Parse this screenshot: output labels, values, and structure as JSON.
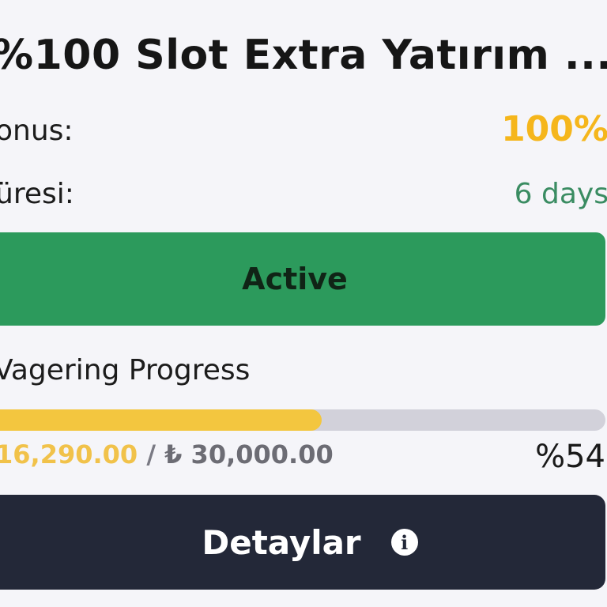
{
  "bonus": {
    "title": "%100 Slot Extra Yatırım ...",
    "bonus_label": "onus:",
    "bonus_value": "100%",
    "duration_label": "üresi:",
    "duration_value": "6 days",
    "status_label": "Active"
  },
  "wagering": {
    "label": "Vagering Progress",
    "current": "16,290.00",
    "separator": "/",
    "total": "₺ 30,000.00",
    "percent_text": "%54",
    "progress_fraction": 0.543
  },
  "details": {
    "label": "Detaylar",
    "icon": "info-icon"
  },
  "colors": {
    "accent_yellow": "#f5b61c",
    "active_green": "#2c9a5c",
    "days_green": "#3a8c62",
    "progress_fill": "#f3c63f",
    "progress_track": "#d2d1da",
    "details_bg": "#232838"
  }
}
